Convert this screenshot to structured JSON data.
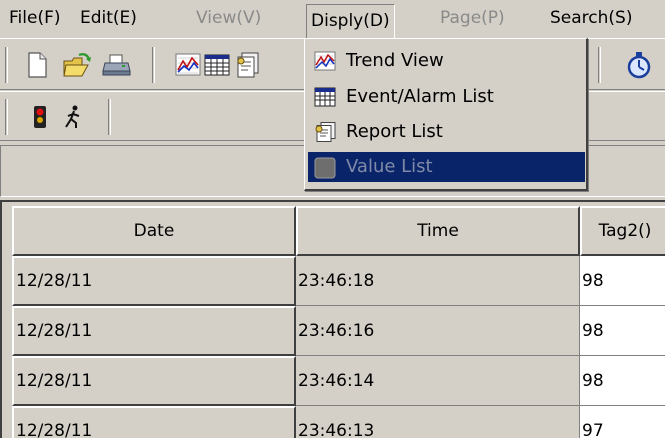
{
  "menubar": {
    "items": [
      {
        "label": "File(F)",
        "state": "enabled"
      },
      {
        "label": "Edit(E)",
        "state": "enabled"
      },
      {
        "label": "View(V)",
        "state": "disabled"
      },
      {
        "label": "Disply(D)",
        "state": "open"
      },
      {
        "label": "Page(P)",
        "state": "disabled"
      },
      {
        "label": "Search(S)",
        "state": "enabled"
      }
    ]
  },
  "toolbar": {
    "icons": [
      "new-file-icon",
      "open-folder-icon",
      "print-icon",
      "trend-view-icon",
      "event-list-icon",
      "report-list-icon",
      "stopwatch-icon"
    ]
  },
  "toolbar2": {
    "icons": [
      "alarm-light-icon",
      "running-man-icon"
    ]
  },
  "dropdown": {
    "items": [
      {
        "label": "Trend View",
        "icon": "trend-view-icon",
        "enabled": true
      },
      {
        "label": "Event/Alarm List",
        "icon": "event-list-icon",
        "enabled": true
      },
      {
        "label": "Report List",
        "icon": "report-list-icon",
        "enabled": true
      },
      {
        "label": "Value List",
        "icon": "value-list-icon",
        "enabled": false,
        "highlighted": true
      }
    ]
  },
  "table": {
    "columns": [
      "Date",
      "Time",
      "Tag2()"
    ],
    "rows": [
      {
        "date": "12/28/11",
        "time": "23:46:18",
        "tag": "98"
      },
      {
        "date": "12/28/11",
        "time": "23:46:16",
        "tag": "98"
      },
      {
        "date": "12/28/11",
        "time": "23:46:14",
        "tag": "98"
      },
      {
        "date": "12/28/11",
        "time": "23:46:13",
        "tag": "97"
      }
    ]
  },
  "colors": {
    "window": "#d4d0c8",
    "highlight": "#0a246a",
    "disabled_text": "#8a8a8a"
  }
}
